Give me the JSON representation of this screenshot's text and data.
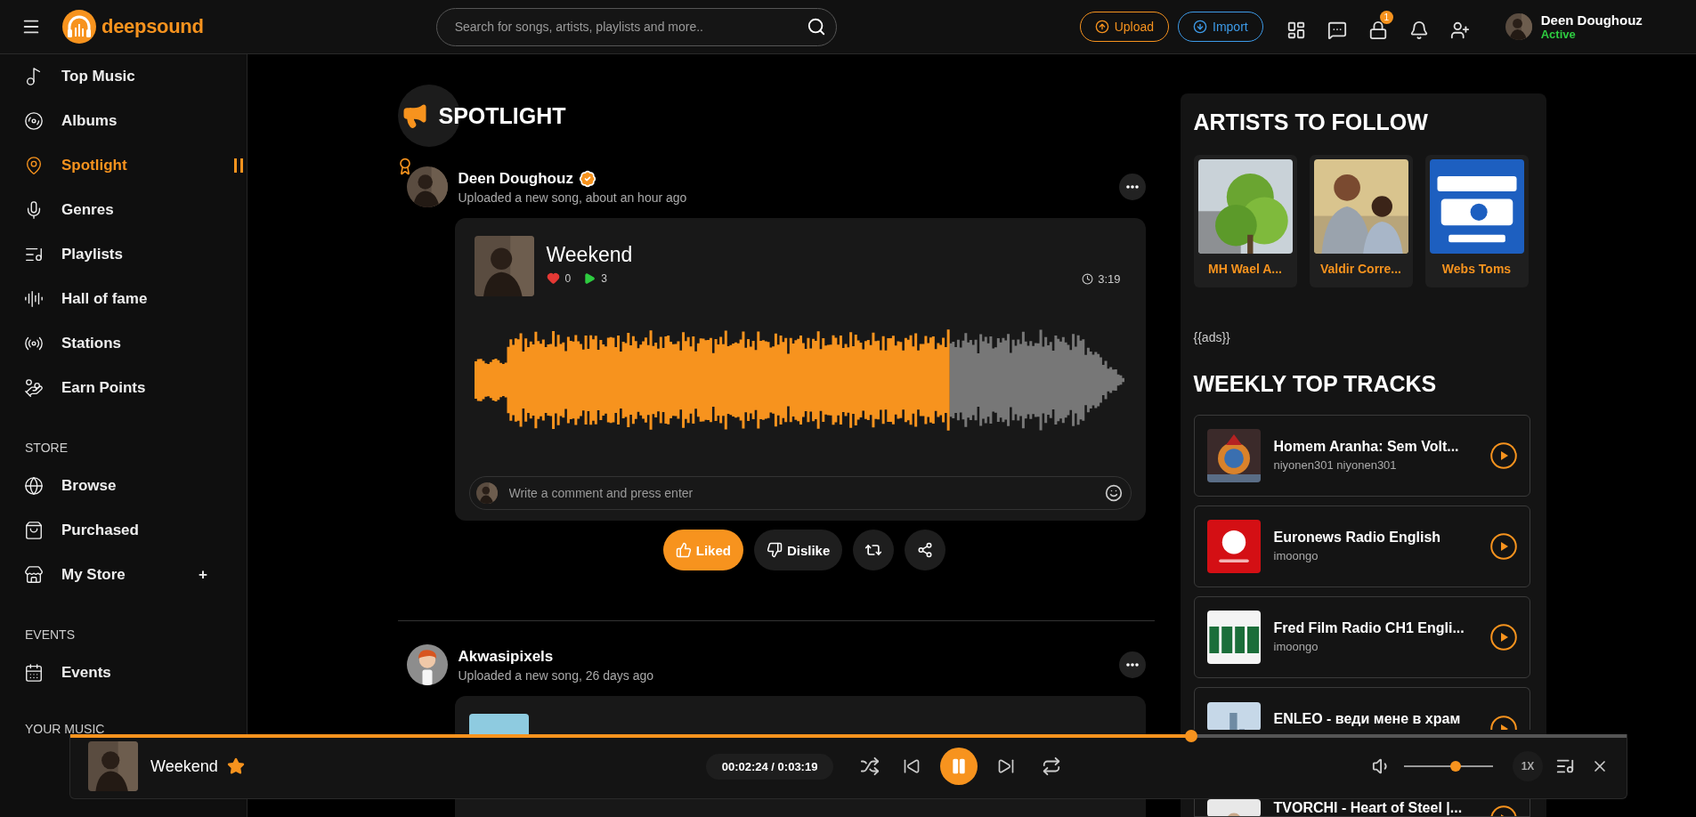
{
  "top_bar": {
    "logo": "deepsound",
    "search": {
      "placeholder": "Search for songs, artists, playlists and more.."
    },
    "buttons": [
      {
        "label": "Upload",
        "kind": "upload"
      },
      {
        "label": "Import",
        "kind": "import"
      }
    ],
    "icons": [
      {
        "kind": "grid"
      },
      {
        "kind": "messages"
      },
      {
        "kind": "store",
        "badge": "1"
      },
      {
        "kind": "notifications"
      },
      {
        "kind": "add-user"
      }
    ],
    "user": {
      "name": "Deen Doughouz",
      "status": "Active"
    }
  },
  "sidebar": {
    "sections": [
      {
        "items": [
          {
            "label": "Top Music",
            "selected": false
          },
          {
            "label": "Albums",
            "selected": false
          },
          {
            "label": "Spotlight",
            "selected": true
          },
          {
            "label": "Genres",
            "selected": false
          },
          {
            "label": "Playlists",
            "selected": false
          },
          {
            "label": "Hall of fame",
            "selected": false
          },
          {
            "label": "Stations",
            "selected": false
          },
          {
            "label": "Earn Points",
            "selected": false
          }
        ]
      },
      {
        "title": "STORE",
        "items": [
          {
            "label": "Browse",
            "selected": false
          },
          {
            "label": "Purchased",
            "selected": false
          },
          {
            "label": "My Store",
            "selected": false,
            "extra": "+"
          }
        ]
      },
      {
        "title": "EVENTS",
        "items": [
          {
            "label": "Events",
            "selected": false
          }
        ]
      },
      {
        "title": "YOUR MUSIC"
      }
    ]
  },
  "feed": {
    "title": "SPOTLIGHT",
    "posts": [
      {
        "author": "Deen Doughouz",
        "verified": true,
        "awarded": true,
        "activity": "Uploaded a new song, about an hour ago",
        "song": {
          "title": "Weekend",
          "likes": "0",
          "plays": "3",
          "duration": "3:19",
          "level": 0.73
        },
        "comment": {
          "placeholder": "Write a comment and press enter"
        },
        "actions": [
          {
            "label": "Liked",
            "kind": "like",
            "selected": true
          },
          {
            "label": "Dislike",
            "kind": "dislike",
            "selected": false
          },
          {
            "kind": "repost"
          },
          {
            "kind": "share"
          }
        ]
      },
      {
        "author": "Akwasipixels",
        "verified": false,
        "awarded": false,
        "activity": "Uploaded a new song, 26 days ago"
      }
    ]
  },
  "right_panel": {
    "artists": {
      "title": "ARTISTS TO FOLLOW",
      "items": [
        {
          "name": "MH Wael A..."
        },
        {
          "name": "Valdir Corre..."
        },
        {
          "name": "Webs Toms"
        }
      ]
    },
    "ads": "{{ads}}",
    "top_tracks": {
      "title": "WEEKLY TOP TRACKS",
      "items": [
        {
          "title": "Homem Aranha: Sem Volt...",
          "artist": "niyonen301 niyonen301"
        },
        {
          "title": "Euronews Radio English",
          "artist": "imoongo"
        },
        {
          "title": "Fred Film Radio CH1 Engli...",
          "artist": "imoongo"
        },
        {
          "title": "ENLEO - веди мене в храм"
        },
        {
          "title": "TVORCHI - Heart of Steel |..."
        }
      ]
    }
  },
  "player": {
    "title": "Weekend",
    "favorite": true,
    "time": "00:02:24 / 0:03:19",
    "level": 0.72,
    "playing": true,
    "volume": {
      "level": 0.58
    },
    "speed": "1X"
  }
}
